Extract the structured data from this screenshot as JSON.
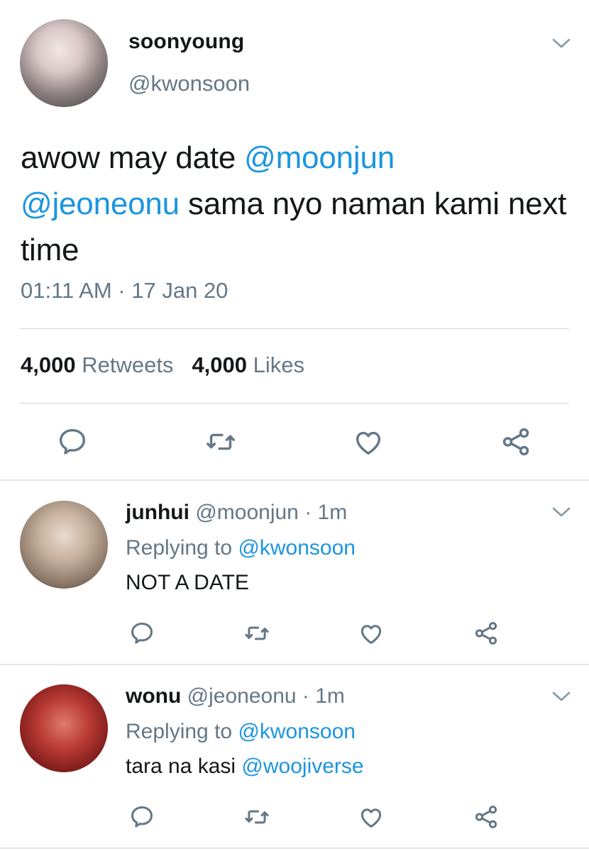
{
  "tweet": {
    "author_name": "soonyoung",
    "author_handle": "@kwonsoon",
    "text_parts": [
      "awow may date ",
      "@moonjun",
      "@jeoneonu",
      " sama nyo naman kami next time"
    ],
    "time": "01:11 AM",
    "separator": " · ",
    "date": "17 Jan 20",
    "retweets_count": "4,000",
    "retweets_label": "Retweets",
    "likes_count": "4,000",
    "likes_label": "Likes",
    "icons": [
      "reply-icon",
      "retweet-icon",
      "like-icon",
      "share-icon"
    ]
  },
  "replies": [
    {
      "name": "junhui",
      "handle": "@moonjun",
      "time": " · 1m",
      "replying_label": "Replying to",
      "replying_handle": "@kwonsoon",
      "text": "NOT A DATE",
      "text_mention": ""
    },
    {
      "name": "wonu",
      "handle": "@jeoneonu",
      "time": " · 1m",
      "replying_label": "Replying to",
      "replying_handle": "@kwonsoon",
      "text": "tara na kasi ",
      "text_mention": "@woojiverse"
    }
  ],
  "colors": {
    "link": "#1b95e0",
    "muted": "#657786",
    "text": "#14171a",
    "divider": "#ccd6dd"
  }
}
